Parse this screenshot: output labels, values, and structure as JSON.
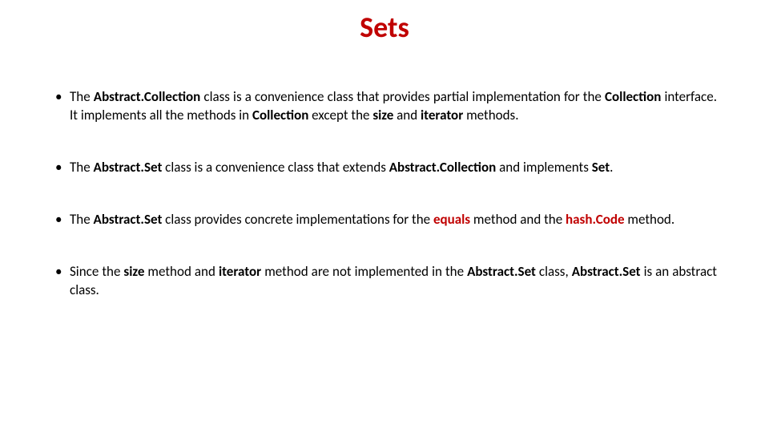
{
  "title": "Sets",
  "bullets": [
    {
      "parts": [
        {
          "t": "The ",
          "cls": ""
        },
        {
          "t": "Abstract.Collection",
          "cls": "bold"
        },
        {
          "t": " class is a convenience class that provides partial implementation for the ",
          "cls": ""
        },
        {
          "t": "Collection",
          "cls": "bold"
        },
        {
          "t": " interface. It implements all the methods in ",
          "cls": ""
        },
        {
          "t": "Collection",
          "cls": "bold"
        },
        {
          "t": " except the ",
          "cls": ""
        },
        {
          "t": "size",
          "cls": "bold"
        },
        {
          "t": " and ",
          "cls": ""
        },
        {
          "t": "iterator",
          "cls": "bold"
        },
        {
          "t": " methods.",
          "cls": ""
        }
      ]
    },
    {
      "parts": [
        {
          "t": "The ",
          "cls": ""
        },
        {
          "t": "Abstract.Set",
          "cls": "bold"
        },
        {
          "t": " class is a convenience class that extends ",
          "cls": ""
        },
        {
          "t": "Abstract.Collection",
          "cls": "bold"
        },
        {
          "t": " and implements ",
          "cls": ""
        },
        {
          "t": "Set",
          "cls": "bold"
        },
        {
          "t": ".",
          "cls": ""
        }
      ]
    },
    {
      "parts": [
        {
          "t": "The ",
          "cls": ""
        },
        {
          "t": "Abstract.Set",
          "cls": "bold"
        },
        {
          "t": " class provides concrete implementations for the ",
          "cls": ""
        },
        {
          "t": "equals",
          "cls": "red-bold"
        },
        {
          "t": " method and the ",
          "cls": ""
        },
        {
          "t": "hash.Code",
          "cls": "red-bold"
        },
        {
          "t": " method.",
          "cls": ""
        }
      ]
    },
    {
      "parts": [
        {
          "t": "Since the ",
          "cls": ""
        },
        {
          "t": "size",
          "cls": "bold"
        },
        {
          "t": " method and ",
          "cls": ""
        },
        {
          "t": "iterator",
          "cls": "bold"
        },
        {
          "t": " method are not implemented in the ",
          "cls": ""
        },
        {
          "t": "Abstract.Set",
          "cls": "bold"
        },
        {
          "t": " class, ",
          "cls": ""
        },
        {
          "t": "Abstract.Set",
          "cls": "bold"
        },
        {
          "t": " is an abstract class.",
          "cls": ""
        }
      ]
    }
  ]
}
